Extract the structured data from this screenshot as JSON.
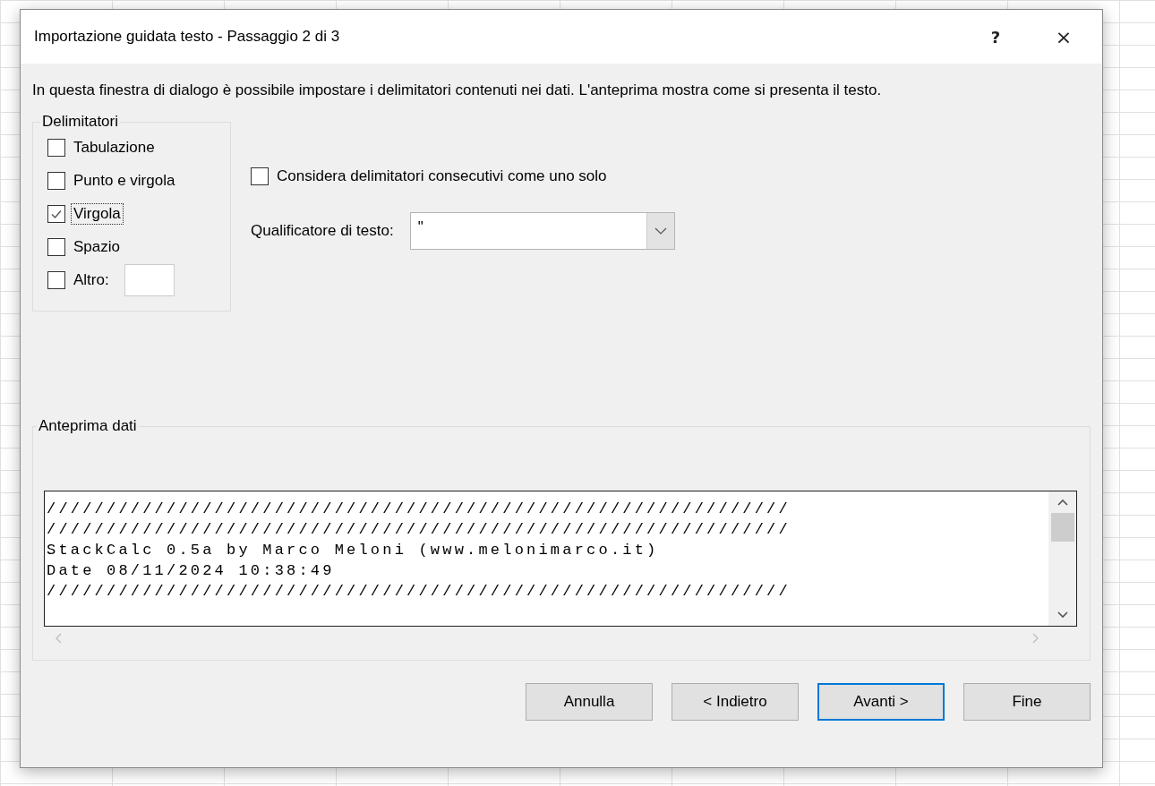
{
  "window": {
    "title": "Importazione guidata testo - Passaggio 2 di 3",
    "help_button": "?",
    "close_button": "×"
  },
  "intro": "In questa finestra di dialogo è possibile impostare i delimitatori contenuti nei dati. L'anteprima mostra come si presenta il testo.",
  "delimiters": {
    "title": "Delimitatori",
    "items": [
      {
        "kind": "check",
        "label": "Tabulazione",
        "checked": false,
        "focused": false
      },
      {
        "kind": "check",
        "label": "Punto e virgola",
        "checked": false,
        "focused": false
      },
      {
        "kind": "check",
        "label": "Virgola",
        "checked": true,
        "focused": true
      },
      {
        "kind": "check",
        "label": "Spazio",
        "checked": false,
        "focused": false
      },
      {
        "kind": "other",
        "label": "Altro:",
        "checked": false,
        "focused": false
      }
    ]
  },
  "consecutive": {
    "label": "Considera delimitatori consecutivi come uno solo",
    "checked": false
  },
  "qualifier": {
    "label": "Qualificatore di testo:",
    "value": "\""
  },
  "preview": {
    "title": "Anteprima dati",
    "lines": [
      "//////////////////////////////////////////////////////////////",
      "//////////////////////////////////////////////////////////////",
      "StackCalc 0.5a by Marco Meloni (www.melonimarco.it)",
      "Date 08/11/2024 10:38:49",
      "//////////////////////////////////////////////////////////////"
    ]
  },
  "buttons": [
    {
      "label": "Annulla",
      "default": false
    },
    {
      "label": "< Indietro",
      "default": false
    },
    {
      "label": "Avanti >",
      "default": true
    },
    {
      "label": "Fine",
      "default": false
    }
  ]
}
